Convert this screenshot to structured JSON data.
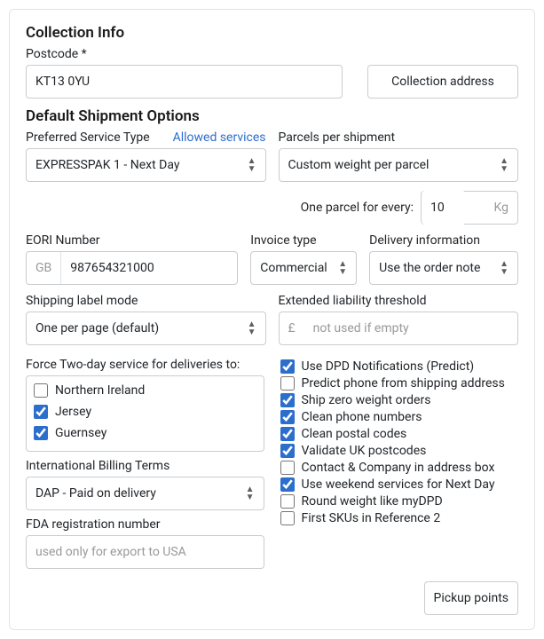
{
  "collection": {
    "heading": "Collection Info",
    "postcode_label": "Postcode *",
    "postcode_value": "KT13 0YU",
    "address_btn": "Collection address"
  },
  "shipment": {
    "heading": "Default Shipment Options",
    "preferred_label": "Preferred Service Type",
    "allowed_link": "Allowed services",
    "preferred_value": "EXPRESSPAK 1 - Next Day",
    "parcels_label": "Parcels per shipment",
    "parcels_value": "Custom weight per parcel",
    "one_parcel_label": "One parcel for every:",
    "one_parcel_value": "10",
    "one_parcel_unit": "Kg",
    "eori_label": "EORI Number",
    "eori_prefix": "GB",
    "eori_value": "987654321000",
    "invoice_label": "Invoice type",
    "invoice_value": "Commercial",
    "delivery_info_label": "Delivery information",
    "delivery_info_value": "Use the order note",
    "label_mode_label": "Shipping label mode",
    "label_mode_value": "One per page (default)",
    "liability_label": "Extended liability threshold",
    "liability_currency": "£",
    "liability_placeholder": "not used if empty"
  },
  "force_two_day": {
    "label": "Force Two-day service for deliveries to:",
    "options": [
      {
        "label": "Northern Ireland",
        "checked": false
      },
      {
        "label": "Jersey",
        "checked": true
      },
      {
        "label": "Guernsey",
        "checked": true
      }
    ]
  },
  "intl_billing": {
    "label": "International Billing Terms",
    "value": "DAP - Paid on delivery"
  },
  "fda": {
    "label": "FDA registration number",
    "placeholder": "used only for export to USA"
  },
  "options": [
    {
      "label": "Use DPD Notifications (Predict)",
      "checked": true
    },
    {
      "label": "Predict phone from shipping address",
      "checked": false
    },
    {
      "label": "Ship zero weight orders",
      "checked": true
    },
    {
      "label": "Clean phone numbers",
      "checked": true
    },
    {
      "label": "Clean postal codes",
      "checked": true
    },
    {
      "label": "Validate UK postcodes",
      "checked": true
    },
    {
      "label": "Contact & Company in address box",
      "checked": false
    },
    {
      "label": "Use weekend services for Next Day",
      "checked": true
    },
    {
      "label": "Round weight like myDPD",
      "checked": false
    },
    {
      "label": "First SKUs in Reference 2",
      "checked": false
    }
  ],
  "footer": {
    "pickup_btn": "Pickup points"
  }
}
